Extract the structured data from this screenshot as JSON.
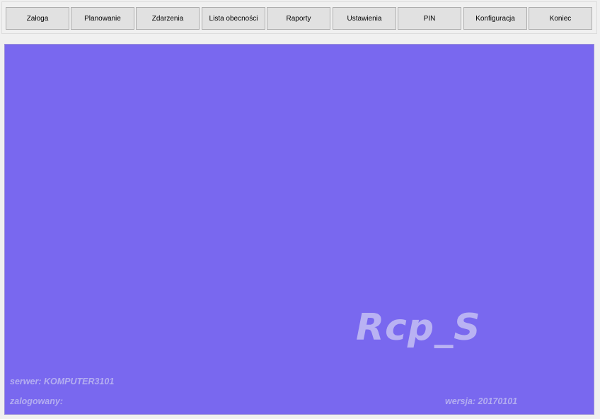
{
  "toolbar": {
    "buttons": [
      {
        "label": "Załoga"
      },
      {
        "label": "Planowanie"
      },
      {
        "label": "Zdarzenia"
      },
      {
        "label": "Lista obecności"
      },
      {
        "label": "Raporty"
      },
      {
        "label": "Ustawienia"
      },
      {
        "label": "PIN"
      },
      {
        "label": "Konfiguracja"
      },
      {
        "label": "Koniec"
      }
    ]
  },
  "main": {
    "logo_text": "Rcp_S",
    "server_text": "serwer: KOMPUTER3101",
    "logged_in_text": "zalogowany:",
    "version_text": "wersja: 20170101"
  },
  "colors": {
    "canvas_background": "#7968ef",
    "logo_color": "#b9b2f3",
    "status_text_color": "#b4aef0"
  }
}
